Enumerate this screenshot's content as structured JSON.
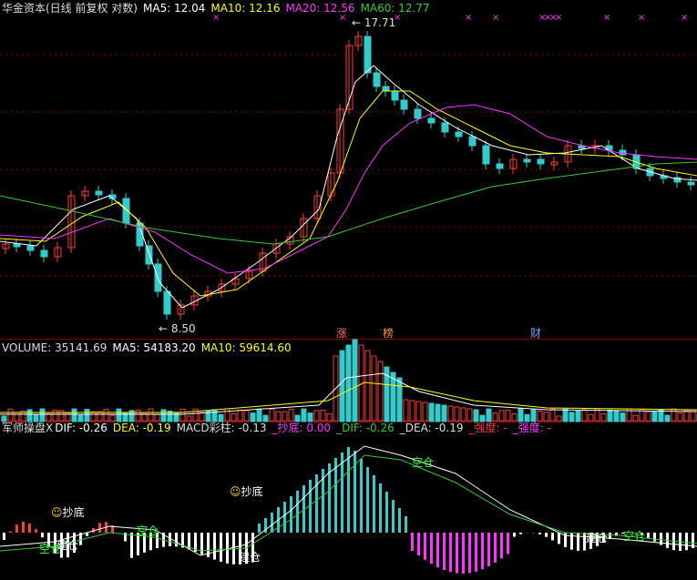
{
  "price_panel": {
    "title": "华金资本(日线 前复权 对数)",
    "ma5_label": "MA5: 12.04",
    "ma10_label": "MA10: 12.16",
    "ma20_label": "MA20: 12.56",
    "ma60_label": "MA60: 12.77",
    "high_marker": "17.71",
    "low_marker": "8.50",
    "event_tags": [
      "涨",
      "榜",
      "财"
    ],
    "x_markers_count": 12
  },
  "volume_panel": {
    "volume_label": "VOLUME: 35141.69",
    "ma5_label": "MA5: 54183.20",
    "ma10_label": "MA10: 59614.60"
  },
  "macd_panel": {
    "name": "军师操盘X",
    "dif_label": "DIF: -0.26",
    "dea_label": "DEA: -0.19",
    "bar_label": "MACD彩柱: -0.13",
    "chaodi_label": "_抄底: 0.00",
    "dif2_label": "_DIF: -0.26",
    "dea2_label": "_DEA: -0.19",
    "qiangdu1_label": "_强度: -",
    "qiangdu2_label": "_强度: -",
    "signals": {
      "chaodi": "抄底",
      "jiancang": "建仓",
      "kongcang": "空仓"
    }
  },
  "colors": {
    "up": "#ff3b3b",
    "down": "#33cccc",
    "ma5": "#ffffff",
    "ma10": "#ffff00",
    "ma20": "#ff33ff",
    "ma60": "#33cc33",
    "grid": "#8b0000"
  }
}
